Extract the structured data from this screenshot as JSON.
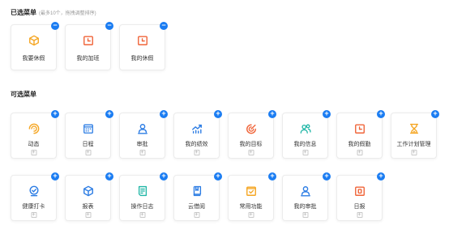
{
  "selected_section": {
    "title": "已选菜单",
    "hint": "(最多10个，拖拽调整排序)"
  },
  "available_section": {
    "title": "可选菜单"
  },
  "badges": {
    "remove": "−",
    "add": "+"
  },
  "add_box_symbol": "+",
  "colors": {
    "badge_blue": "#1a7cf2"
  },
  "selected_items": [
    {
      "label": "我要休假",
      "icon": "cube-icon",
      "color": "#f5a623"
    },
    {
      "label": "我的加班",
      "icon": "calendar-alarm-icon",
      "color": "#f0653a"
    },
    {
      "label": "我的休假",
      "icon": "calendar-alarm-icon",
      "color": "#f0653a"
    }
  ],
  "available_items": [
    {
      "label": "动态",
      "icon": "dynamic-swirl-icon",
      "color": "#f5a623"
    },
    {
      "label": "日程",
      "icon": "calendar-grid-icon",
      "color": "#2d7de4"
    },
    {
      "label": "审批",
      "icon": "person-icon",
      "color": "#2d7de4"
    },
    {
      "label": "我的绩效",
      "icon": "trend-chart-icon",
      "color": "#2d7de4"
    },
    {
      "label": "我的目标",
      "icon": "target-icon",
      "color": "#f0653a"
    },
    {
      "label": "我的信息",
      "icon": "people-icon",
      "color": "#1fb6a6"
    },
    {
      "label": "我的假勤",
      "icon": "calendar-alarm-icon",
      "color": "#f0653a"
    },
    {
      "label": "工作计划管理",
      "icon": "hourglass-icon",
      "color": "#f5a623"
    },
    {
      "label": "健康打卡",
      "icon": "health-check-icon",
      "color": "#2d7de4"
    },
    {
      "label": "报表",
      "icon": "cube-icon",
      "color": "#2d7de4"
    },
    {
      "label": "操作日志",
      "icon": "log-document-icon",
      "color": "#1fb6a6"
    },
    {
      "label": "云借阅",
      "icon": "book-icon",
      "color": "#2d7de4"
    },
    {
      "label": "常用功能",
      "icon": "check-square-icon",
      "color": "#f5a623"
    },
    {
      "label": "我的审批",
      "icon": "person-icon",
      "color": "#2d7de4"
    },
    {
      "label": "日报",
      "icon": "daily-report-icon",
      "color": "#f0653a"
    }
  ]
}
